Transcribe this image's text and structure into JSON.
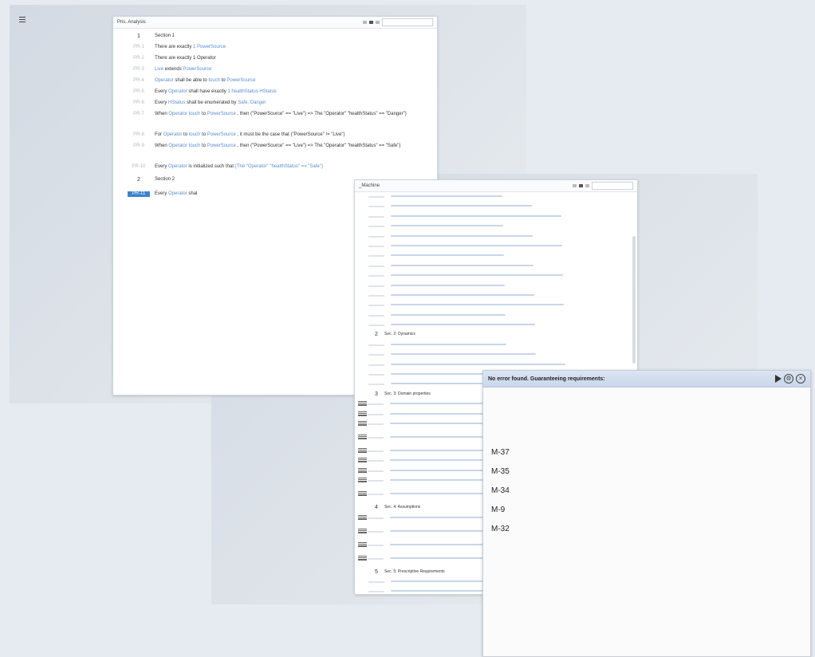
{
  "window1": {
    "title": "Pris. Analysis",
    "rows": [
      {
        "id": "1",
        "text": "Section 1",
        "section": true
      },
      {
        "id": "PR-1",
        "segments": [
          {
            "t": "There are exactly "
          },
          {
            "t": "1 PowerSource",
            "hl": true
          }
        ]
      },
      {
        "id": "PR-2",
        "segments": [
          {
            "t": "There are exactly 1 Operator"
          }
        ]
      },
      {
        "id": "PR-3",
        "segments": [
          {
            "t": "Live",
            "hl": true
          },
          {
            "t": " extends "
          },
          {
            "t": "PowerSource",
            "hl": true
          }
        ]
      },
      {
        "id": "PR-4",
        "segments": [
          {
            "t": "Operator",
            "hl": true
          },
          {
            "t": " shall be able to "
          },
          {
            "t": "touch",
            "hl": true
          },
          {
            "t": " to "
          },
          {
            "t": "PowerSource",
            "hl": true
          }
        ]
      },
      {
        "id": "PR-5",
        "segments": [
          {
            "t": "Every "
          },
          {
            "t": "Operator",
            "hl": true
          },
          {
            "t": " shall have exactly "
          },
          {
            "t": "1 healthStatus HStatus",
            "hl": true
          }
        ]
      },
      {
        "id": "PR-6",
        "segments": [
          {
            "t": "Every "
          },
          {
            "t": "HStatus",
            "hl": true
          },
          {
            "t": " shall be enumerated by "
          },
          {
            "t": "Safe, Danger",
            "hl": true
          }
        ]
      },
      {
        "id": "PR-7",
        "segments": [
          {
            "t": "When "
          },
          {
            "t": "Operator",
            "hl": true
          },
          {
            "t": " "
          },
          {
            "t": "touch",
            "hl": true
          },
          {
            "t": " to "
          },
          {
            "t": "PowerSource",
            "hl": true
          },
          {
            "t": " , then (\"PowerSource\" == \"Live\") => The \"Operator\" \"healthStatus\" == \"Danger\")"
          }
        ]
      },
      {
        "id": "PR-8",
        "segments": [
          {
            "t": "For "
          },
          {
            "t": "Operator",
            "hl": true
          },
          {
            "t": " to "
          },
          {
            "t": "touch",
            "hl": true
          },
          {
            "t": " to "
          },
          {
            "t": "PowerSource",
            "hl": true
          },
          {
            "t": " , it must be the case that (\"PowerSource\" != \"Live\")"
          }
        ]
      },
      {
        "id": "PR-9",
        "segments": [
          {
            "t": "When "
          },
          {
            "t": "Operator",
            "hl": true
          },
          {
            "t": " "
          },
          {
            "t": "touch",
            "hl": true
          },
          {
            "t": " to "
          },
          {
            "t": "PowerSource",
            "hl": true
          },
          {
            "t": " , then (\"PowerSource\" == \"Live\") => The \"Operator\" \"healthStatus\" == \"Safe\")"
          }
        ]
      },
      {
        "id": "PR-10",
        "segments": [
          {
            "t": "Every "
          },
          {
            "t": "Operator",
            "hl": true
          },
          {
            "t": " is initialized such that "
          },
          {
            "t": "(The \"Operator\" \"healthStatus\" == \"Safe\")",
            "hl": true
          }
        ]
      },
      {
        "id": "2",
        "text": "Section 2",
        "section": true
      },
      {
        "id": "PR-11",
        "selected": true,
        "segments": [
          {
            "t": "Every "
          },
          {
            "t": "Operator",
            "hl": true
          },
          {
            "t": " shal"
          }
        ]
      }
    ]
  },
  "window2": {
    "title": "_Machine",
    "sections": [
      {
        "row": 14,
        "id": "2",
        "label": "Sec. 2: Dynamics"
      },
      {
        "row": 20,
        "id": "3",
        "label": "Sec. 3: Domain properties"
      },
      {
        "row": 30,
        "id": "4",
        "label": "Sec. 4: Assumptions"
      },
      {
        "row": 35,
        "id": "5",
        "label": "Sec. 5: Prescriptive Requirements"
      }
    ]
  },
  "result": {
    "title": "No error found. Guaranteeing requirements:",
    "requirements": [
      "M-37",
      "M-35",
      "M-34",
      "M-9",
      "M-32"
    ]
  },
  "colors": {
    "accent": "#5b8ed2",
    "selected": "#3d84cc",
    "header": "#c9d7ea"
  },
  "icons": {
    "menu": "menu-icon",
    "play": "play-icon",
    "settings": "gear-icon",
    "close": "close-icon"
  }
}
